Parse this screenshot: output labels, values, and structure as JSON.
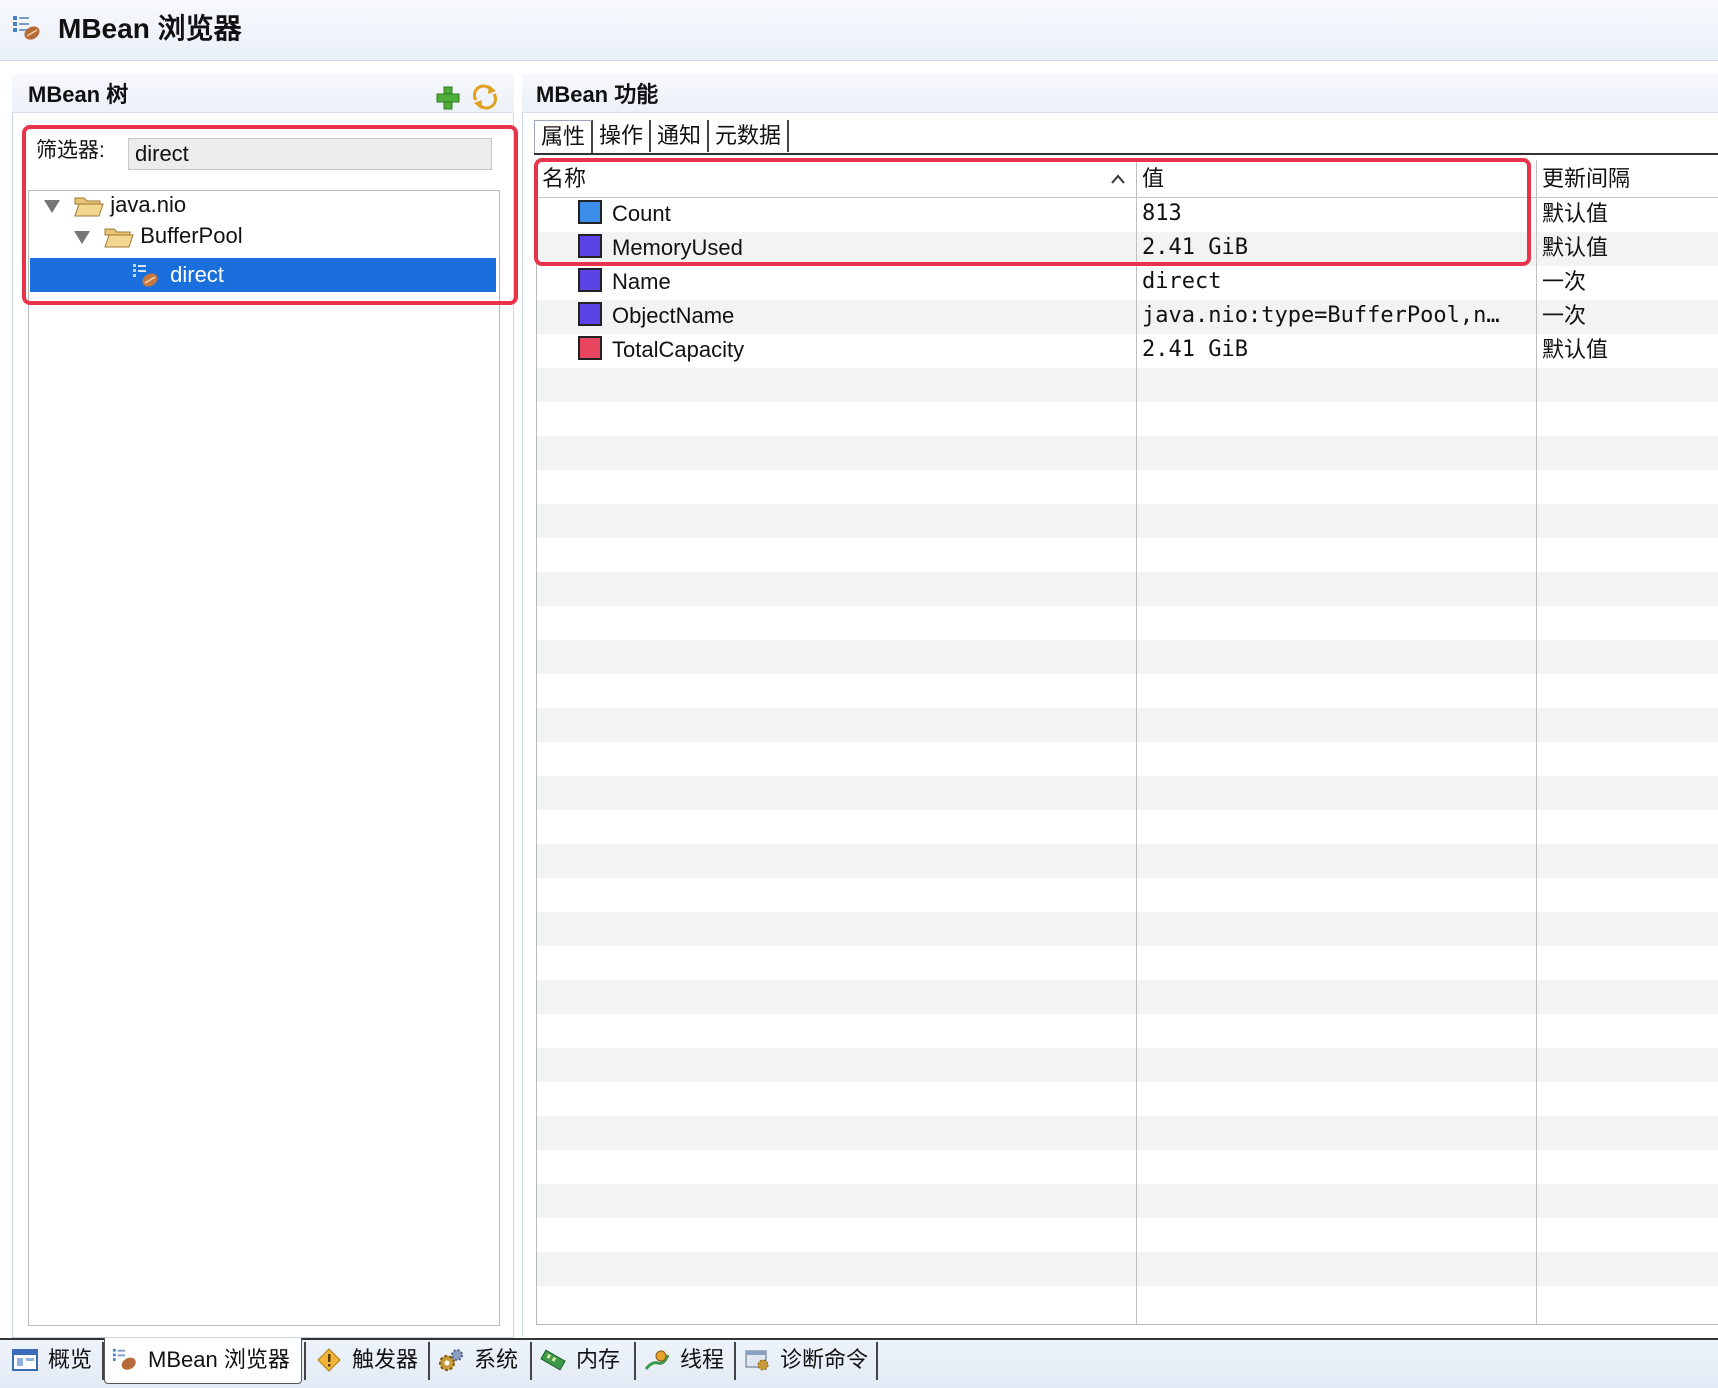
{
  "window": {
    "title": "MBean 浏览器"
  },
  "tree_panel": {
    "title": "MBean 树",
    "filter_label": "筛选器:",
    "filter_value": "direct",
    "nodes": [
      {
        "label": "java.nio",
        "expanded": true
      },
      {
        "label": "BufferPool",
        "expanded": true
      },
      {
        "label": "direct",
        "selected": true
      }
    ]
  },
  "feature_panel": {
    "title": "MBean 功能",
    "tabs": [
      "属性",
      "操作",
      "通知",
      "元数据"
    ],
    "active_tab": "属性",
    "columns": {
      "name": "名称",
      "value": "值",
      "interval": "更新间隔"
    },
    "rows": [
      {
        "name": "Count",
        "value": "813",
        "interval": "默认值",
        "color": "#3b8ee8"
      },
      {
        "name": "MemoryUsed",
        "value": "2.41 GiB",
        "interval": "默认值",
        "color": "#5a44e6"
      },
      {
        "name": "Name",
        "value": "direct",
        "interval": "一次",
        "color": "#5a44e6"
      },
      {
        "name": "ObjectName",
        "value": "java.nio:type=BufferPool,n…",
        "interval": "一次",
        "color": "#5a44e6"
      },
      {
        "name": "TotalCapacity",
        "value": "2.41 GiB",
        "interval": "默认值",
        "color": "#e8445e"
      }
    ]
  },
  "bottom_tabs": [
    {
      "label": "概览",
      "icon": "overview-icon"
    },
    {
      "label": "MBean 浏览器",
      "icon": "mbean-browser-icon",
      "active": true
    },
    {
      "label": "触发器",
      "icon": "trigger-warning-icon"
    },
    {
      "label": "系统",
      "icon": "system-gears-icon"
    },
    {
      "label": "内存",
      "icon": "memory-icon"
    },
    {
      "label": "线程",
      "icon": "thread-icon"
    },
    {
      "label": "诊断命令",
      "icon": "diagnostic-command-icon"
    }
  ],
  "colors": {
    "selection": "#1a6fdc",
    "highlight": "#e8334a"
  }
}
